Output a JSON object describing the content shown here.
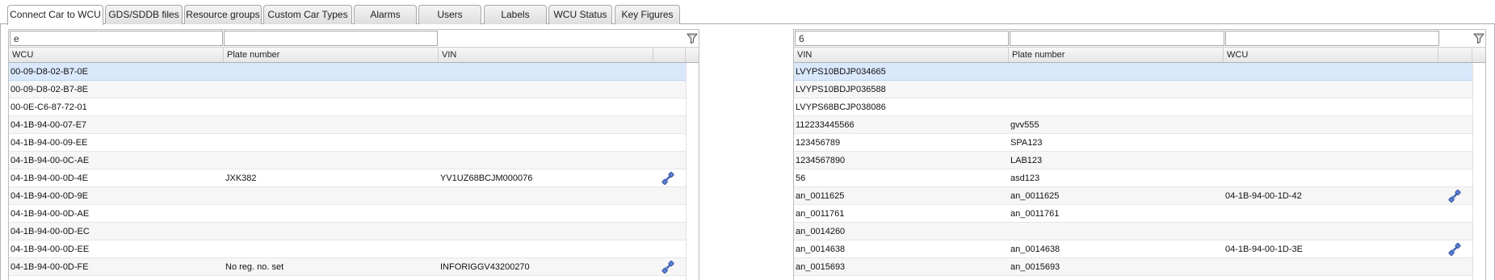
{
  "tabs": [
    {
      "label": "Connect Car to WCU",
      "active": true
    },
    {
      "label": "GDS/SDDB files",
      "active": false
    },
    {
      "label": "Resource groups",
      "active": false
    },
    {
      "label": "Custom Car Types",
      "active": false
    },
    {
      "label": "Alarms",
      "active": false
    },
    {
      "label": "Users",
      "active": false
    },
    {
      "label": "Labels",
      "active": false
    },
    {
      "label": "WCU Status",
      "active": false
    },
    {
      "label": "Key Figures",
      "active": false
    }
  ],
  "left_panel": {
    "filter": {
      "wcu": "e",
      "plate": "",
      "vin": ""
    },
    "columns": [
      "WCU",
      "Plate number",
      "VIN"
    ],
    "rows": [
      {
        "wcu": "00-09-D8-02-B7-0E",
        "plate": "",
        "vin": "",
        "linked": false,
        "selected": true
      },
      {
        "wcu": "00-09-D8-02-B7-8E",
        "plate": "",
        "vin": "",
        "linked": false
      },
      {
        "wcu": "00-0E-C6-87-72-01",
        "plate": "",
        "vin": "",
        "linked": false
      },
      {
        "wcu": "04-1B-94-00-07-E7",
        "plate": "",
        "vin": "",
        "linked": false
      },
      {
        "wcu": "04-1B-94-00-09-EE",
        "plate": "",
        "vin": "",
        "linked": false
      },
      {
        "wcu": "04-1B-94-00-0C-AE",
        "plate": "",
        "vin": "",
        "linked": false
      },
      {
        "wcu": "04-1B-94-00-0D-4E",
        "plate": "JXK382",
        "vin": "YV1UZ68BCJM000076",
        "linked": true
      },
      {
        "wcu": "04-1B-94-00-0D-9E",
        "plate": "",
        "vin": "",
        "linked": false
      },
      {
        "wcu": "04-1B-94-00-0D-AE",
        "plate": "",
        "vin": "",
        "linked": false
      },
      {
        "wcu": "04-1B-94-00-0D-EC",
        "plate": "",
        "vin": "",
        "linked": false
      },
      {
        "wcu": "04-1B-94-00-0D-EE",
        "plate": "",
        "vin": "",
        "linked": false
      },
      {
        "wcu": "04-1B-94-00-0D-FE",
        "plate": "No reg. no. set",
        "vin": "INFORIGGV43200270",
        "linked": true
      }
    ]
  },
  "right_panel": {
    "filter": {
      "vin": "6",
      "plate": "",
      "wcu": ""
    },
    "columns": [
      "VIN",
      "Plate number",
      "WCU"
    ],
    "rows": [
      {
        "vin": "LVYPS10BDJP034665",
        "plate": "",
        "wcu": "",
        "linked": false,
        "selected": true
      },
      {
        "vin": "LVYPS10BDJP036588",
        "plate": "",
        "wcu": "",
        "linked": false
      },
      {
        "vin": "LVYPS68BCJP038086",
        "plate": "",
        "wcu": "",
        "linked": false
      },
      {
        "vin": "112233445566",
        "plate": "gvv555",
        "wcu": "",
        "linked": false
      },
      {
        "vin": "123456789",
        "plate": "SPA123",
        "wcu": "",
        "linked": false
      },
      {
        "vin": "1234567890",
        "plate": "LAB123",
        "wcu": "",
        "linked": false
      },
      {
        "vin": "56",
        "plate": "asd123",
        "wcu": "",
        "linked": false
      },
      {
        "vin": "an_0011625",
        "plate": "an_0011625",
        "wcu": "04-1B-94-00-1D-42",
        "linked": true
      },
      {
        "vin": "an_0011761",
        "plate": "an_0011761",
        "wcu": "",
        "linked": false
      },
      {
        "vin": "an_0014260",
        "plate": "",
        "wcu": "",
        "linked": false
      },
      {
        "vin": "an_0014638",
        "plate": "an_0014638",
        "wcu": "04-1B-94-00-1D-3E",
        "linked": true
      },
      {
        "vin": "an_0015693",
        "plate": "an_0015693",
        "wcu": "",
        "linked": false
      }
    ]
  },
  "icons": {
    "filter": "funnel-icon",
    "linked": "connection-link-icon"
  },
  "colors": {
    "selected_row": "#d9e8fb",
    "alt_row": "#f6f6f6",
    "link_icon": "#3d5fb0"
  }
}
